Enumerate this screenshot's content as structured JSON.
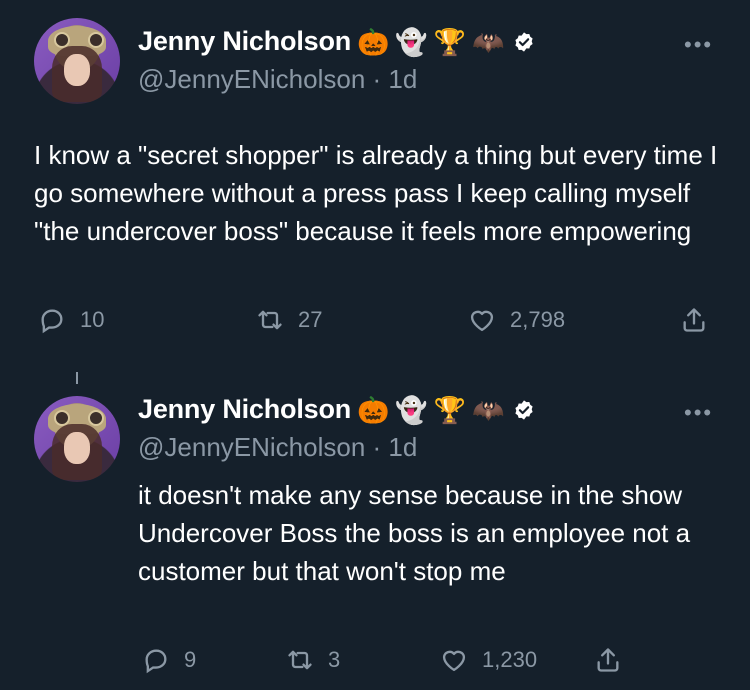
{
  "tweets": [
    {
      "author": "Jenny Nicholson",
      "emojis": [
        "🎃",
        "👻",
        "🏆",
        "🦇"
      ],
      "handle": "@JennyENicholson",
      "time": "1d",
      "text": "I know a \"secret shopper\" is already a thing but every time I go somewhere without a press pass I keep calling myself \"the undercover boss\" because it feels more empowering",
      "replies": "10",
      "retweets": "27",
      "likes": "2,798"
    },
    {
      "author": "Jenny Nicholson",
      "emojis": [
        "🎃",
        "👻",
        "🏆",
        "🦇"
      ],
      "handle": "@JennyENicholson",
      "time": "1d",
      "text": "it doesn't make any sense because in the show Undercover Boss the boss is an employee not a customer but that won't stop me",
      "replies": "9",
      "retweets": "3",
      "likes": "1,230"
    }
  ],
  "more_label": "•••",
  "colors": {
    "background": "#15202b",
    "text": "#ffffff",
    "secondary": "#8b98a5",
    "verified": "#ffffff"
  }
}
